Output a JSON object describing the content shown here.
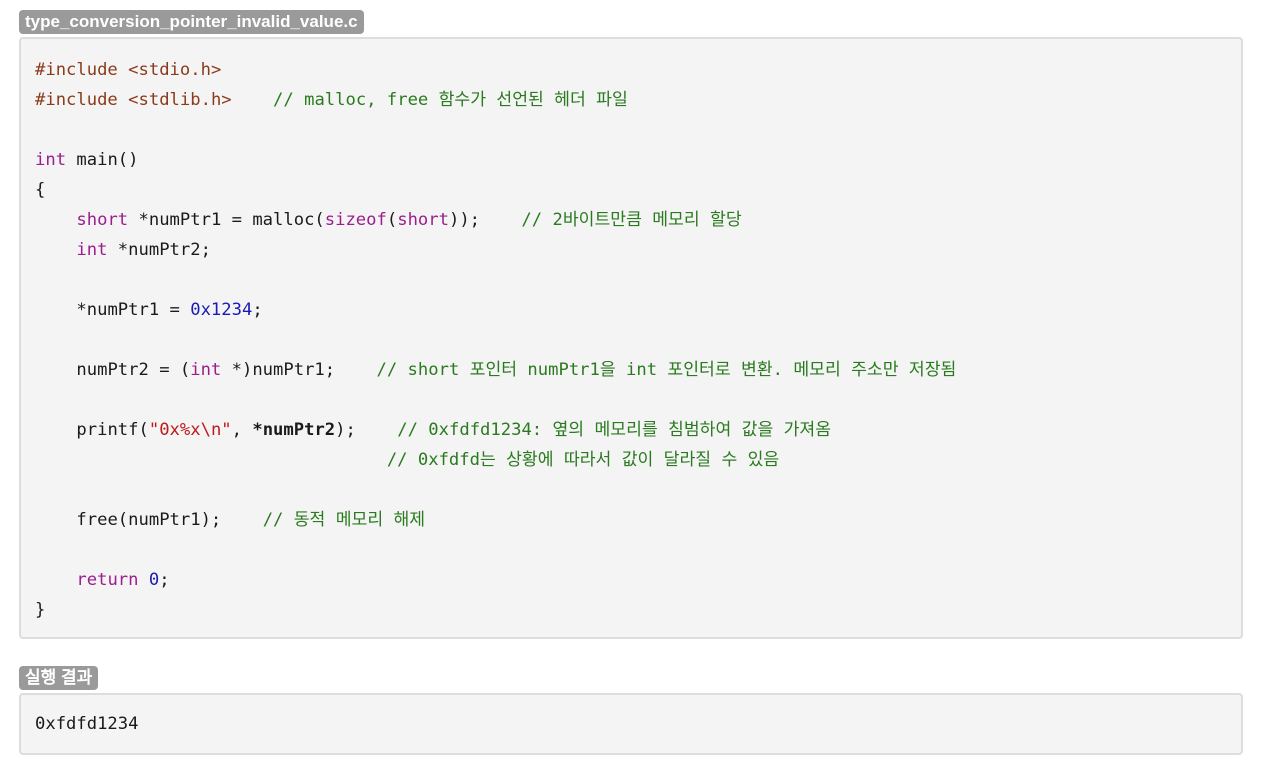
{
  "file_title": "type_conversion_pointer_invalid_value.c",
  "code": {
    "include_kw": "#include",
    "stdio": "<stdio.h>",
    "stdlib": "<stdlib.h>",
    "stdlib_comment": "// malloc, free 함수가 선언된 헤더 파일",
    "int_kw": "int",
    "main_sig": " main()",
    "open_brace": "{",
    "close_brace": "}",
    "indent": "    ",
    "short_kw": "short",
    "line_short_a": " *numPtr1 = malloc(",
    "sizeof_kw": "sizeof",
    "paren_open": "(",
    "line_short_b": "));",
    "comment_alloc": "// 2바이트만큼 메모리 할당",
    "line_int_ptr": " *numPtr2;",
    "assign_a": "*numPtr1 = ",
    "hex_value": "0x1234",
    "semicolon": ";",
    "cast_a": "numPtr2 = (",
    "cast_b": " *)numPtr1;",
    "comment_cast": "// short 포인터 numPtr1을 int 포인터로 변환. 메모리 주소만 저장됨",
    "printf_a": "printf(",
    "fmt_str_a": "\"0x%x",
    "fmt_esc": "\\n",
    "fmt_str_b": "\"",
    "printf_b": ", ",
    "printf_arg": "*numPtr2",
    "printf_c": ");",
    "comment_printf1": "// 0xfdfd1234: 옆의 메모리를 침범하여 값을 가져옴",
    "comment_printf2": "// 0xfdfd는 상황에 따라서 값이 달라질 수 있음",
    "free_call": "free(numPtr1);",
    "comment_free": "// 동적 메모리 해제",
    "return_kw": "return",
    "zero": "0"
  },
  "result_title": "실행 결과",
  "result_output": "0xfdfd1234"
}
